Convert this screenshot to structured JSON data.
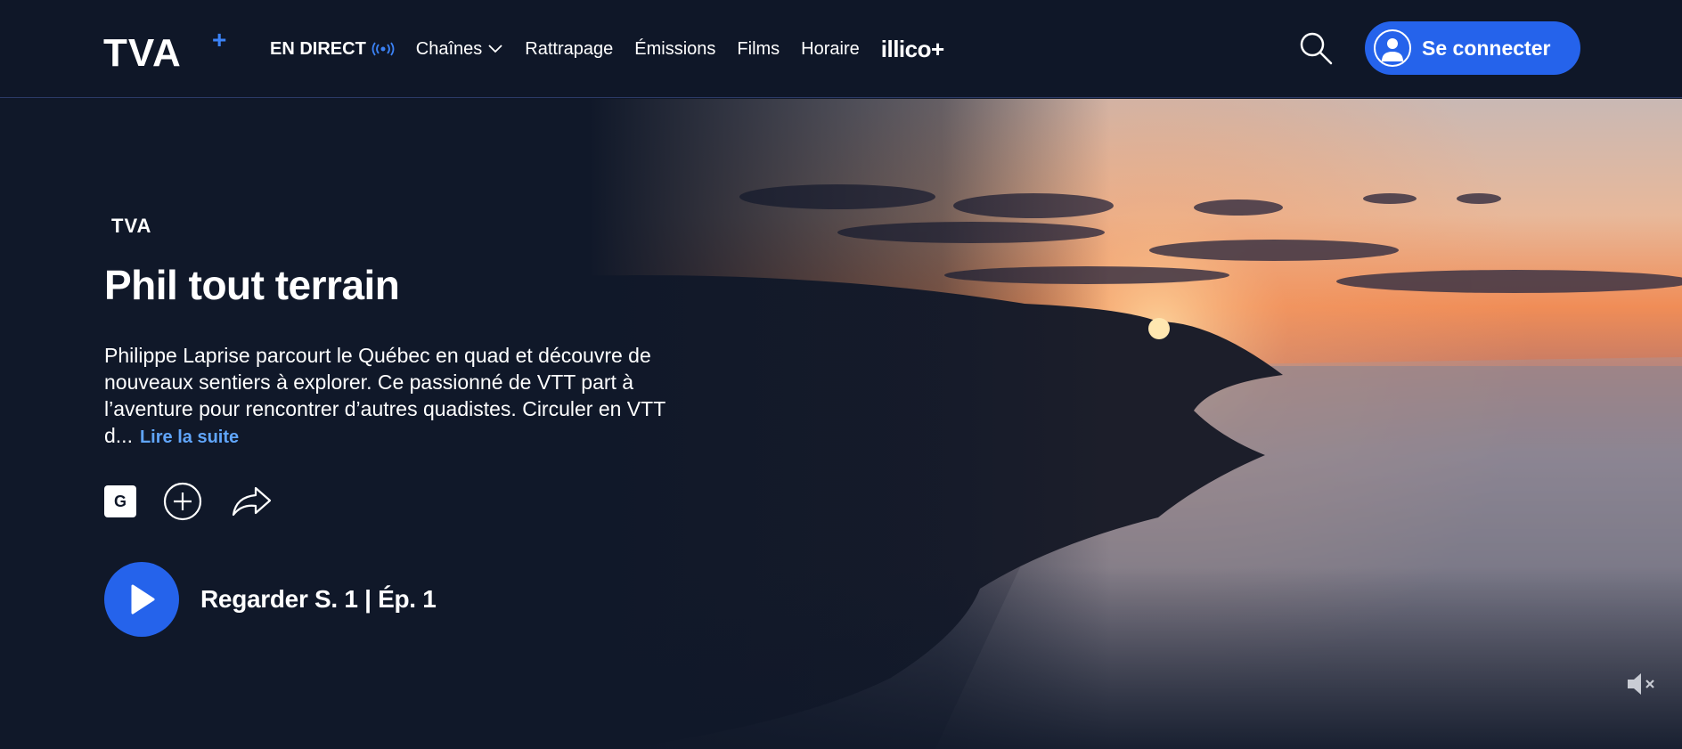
{
  "header": {
    "logo_text": "TVA+",
    "nav": [
      {
        "label": "EN DIRECT"
      },
      {
        "label": "Chaînes"
      },
      {
        "label": "Rattrapage"
      },
      {
        "label": "Émissions"
      },
      {
        "label": "Films"
      },
      {
        "label": "Horaire"
      },
      {
        "label": "illico+"
      }
    ],
    "connect_label": "Se connecter"
  },
  "hero": {
    "channel_logo_text": "TVA",
    "title": "Phil tout terrain",
    "description": "Philippe Laprise parcourt le Québec en quad et découvre de nouveaux sentiers à explorer. Ce passionné de VTT part à l’aventure pour rencontrer d’autres quadistes. Circuler en VTT d...",
    "read_more": "Lire la suite",
    "rating": "G",
    "watch_label": "Regarder S. 1 | Ép. 1"
  },
  "icons": {
    "live": "broadcast-icon",
    "chevron": "chevron-down-icon",
    "search": "search-icon",
    "user": "user-icon",
    "add": "plus-circle-icon",
    "share": "share-icon",
    "play": "play-icon",
    "mute": "speaker-muted-icon"
  },
  "colors": {
    "background": "#0f1728",
    "accent": "#2563eb",
    "link": "#60a5fa"
  }
}
